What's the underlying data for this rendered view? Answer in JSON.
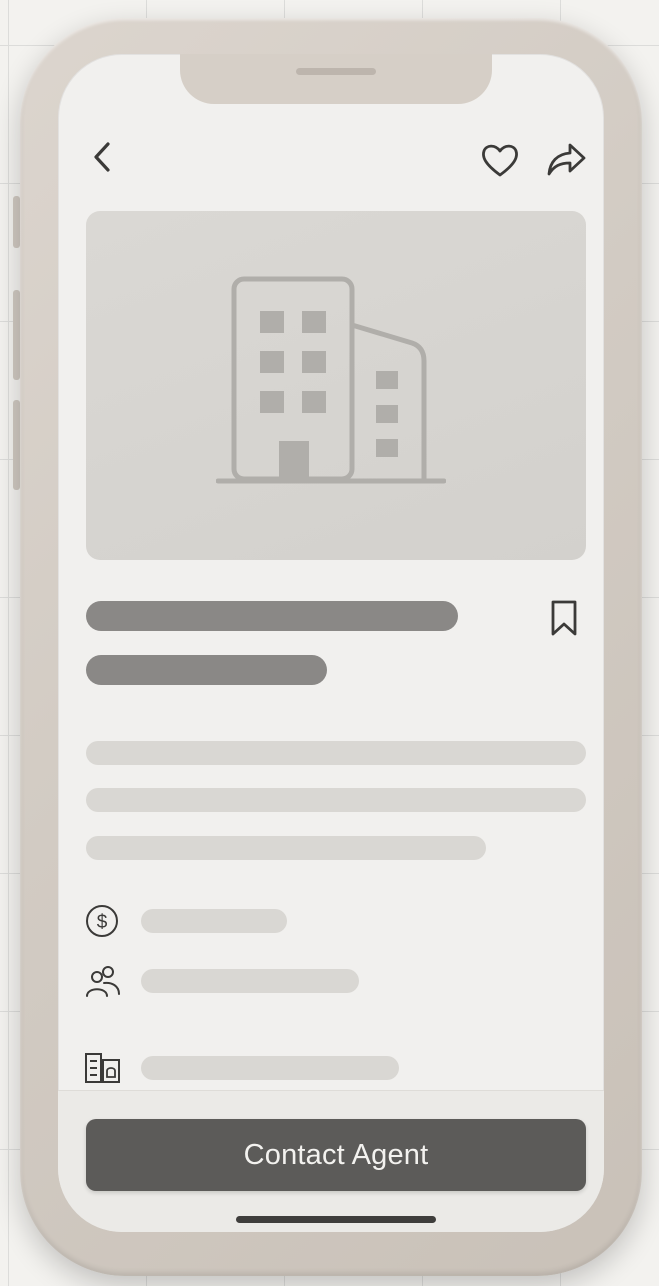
{
  "header": {
    "back_icon": "chevron-left-icon",
    "favorite_icon": "heart-icon",
    "share_icon": "share-arrow-icon"
  },
  "hero": {
    "image_icon": "building-icon"
  },
  "title_block": {
    "bookmark_icon": "bookmark-icon"
  },
  "details": [
    {
      "icon": "dollar-circle-icon"
    },
    {
      "icon": "people-icon"
    },
    {
      "icon": "floor-plan-icon"
    }
  ],
  "footer": {
    "cta_label": "Contact Agent"
  },
  "colors": {
    "frame": "#d2cbc3",
    "screen_background": "#f1f0ee",
    "button_background": "#5c5b59",
    "button_text": "#f3f2ef",
    "skeleton_dark": "#8a8886",
    "skeleton_light": "#d9d7d3"
  }
}
